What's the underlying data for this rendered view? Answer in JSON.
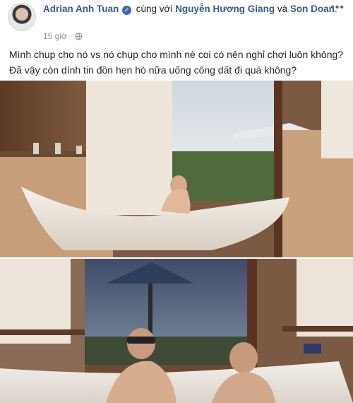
{
  "post": {
    "author": "Adrian Anh Tuan",
    "with_text": "cùng với",
    "tag1": "Nguyễn Hương Giang",
    "and_text": "và",
    "tag2": "Son Doan",
    "period": ".",
    "time": "15 giờ",
    "line1": "Mình chụp cho nó vs nó chụp cho mình nè coi có nên nghỉ chơi luôn không?",
    "line2": "Đã vậy còn dính tin đồn hẹn hò nữa uống công dất đi quá không?"
  },
  "icons": {
    "verified": "verified-badge",
    "privacy": "globe-icon",
    "menu": "more-options-icon"
  },
  "colors": {
    "link": "#385898",
    "meta": "#90949c",
    "verified": "#4267b2"
  }
}
